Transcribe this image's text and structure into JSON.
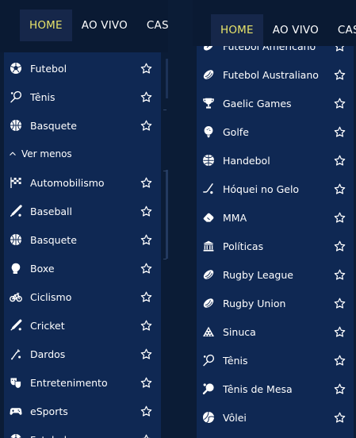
{
  "colors": {
    "background": "#0b1c36",
    "nav_background": "#0a1a33",
    "nav_active_bg": "#16274a",
    "nav_active_text": "#e8e36a",
    "list_background": "#0f2853",
    "text": "#ffffff"
  },
  "left": {
    "nav": [
      "HOME",
      "AO VIVO",
      "CASSI"
    ],
    "list": [
      {
        "label": "Futebol",
        "icon": "soccer-ball-icon"
      },
      {
        "label": "Tênis",
        "icon": "tennis-racket-icon"
      },
      {
        "label": "Basquete",
        "icon": "basketball-icon"
      },
      {
        "label": "Ver menos",
        "icon": "chevron-up-icon",
        "toggle": true
      },
      {
        "label": "Automobilismo",
        "icon": "checkered-flag-icon"
      },
      {
        "label": "Baseball",
        "icon": "baseball-bat-icon"
      },
      {
        "label": "Basquete",
        "icon": "basketball-icon"
      },
      {
        "label": "Boxe",
        "icon": "boxing-glove-icon"
      },
      {
        "label": "Ciclismo",
        "icon": "bicycle-icon"
      },
      {
        "label": "Cricket",
        "icon": "cricket-bat-icon"
      },
      {
        "label": "Dardos",
        "icon": "darts-icon"
      },
      {
        "label": "Entretenimento",
        "icon": "theater-masks-icon"
      },
      {
        "label": "eSports",
        "icon": "gamepad-icon"
      },
      {
        "label": "Futebol",
        "icon": "soccer-ball-icon"
      }
    ]
  },
  "right": {
    "nav": [
      "HOME",
      "AO VIVO",
      "CASS"
    ],
    "list": [
      {
        "label": "Futebol Americano",
        "icon": "american-football-icon"
      },
      {
        "label": "Futebol Australiano",
        "icon": "rugby-ball-icon"
      },
      {
        "label": "Gaelic Games",
        "icon": "trophy-icon"
      },
      {
        "label": "Golfe",
        "icon": "golf-ball-icon"
      },
      {
        "label": "Handebol",
        "icon": "handball-icon"
      },
      {
        "label": "Hóquei no Gelo",
        "icon": "hockey-stick-icon"
      },
      {
        "label": "MMA",
        "icon": "mma-glove-icon"
      },
      {
        "label": "Políticas",
        "icon": "government-building-icon"
      },
      {
        "label": "Rugby League",
        "icon": "rugby-ball-icon"
      },
      {
        "label": "Rugby Union",
        "icon": "rugby-ball-icon"
      },
      {
        "label": "Sinuca",
        "icon": "billiard-rack-icon"
      },
      {
        "label": "Tênis",
        "icon": "tennis-racket-icon"
      },
      {
        "label": "Tênis de Mesa",
        "icon": "table-tennis-icon"
      },
      {
        "label": "Vôlei",
        "icon": "volleyball-icon"
      }
    ]
  }
}
